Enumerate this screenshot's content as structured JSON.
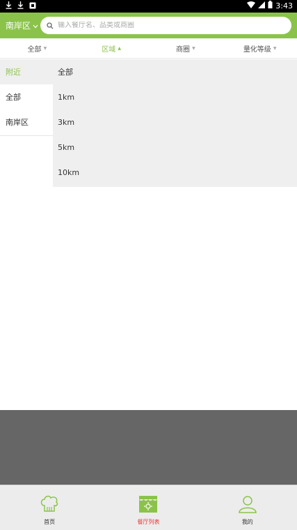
{
  "status_bar": {
    "time": "3:43"
  },
  "header": {
    "city_label": "南岸区",
    "search_placeholder": "输入餐厅名、品类或商圈"
  },
  "filter_bar": {
    "tabs": [
      {
        "label": "全部"
      },
      {
        "label": "区域"
      },
      {
        "label": "商圈"
      },
      {
        "label": "量化等级"
      }
    ]
  },
  "region_panel": {
    "left_items": [
      {
        "label": "附近"
      },
      {
        "label": "全部"
      },
      {
        "label": "南岸区"
      }
    ],
    "right_items": [
      {
        "label": "全部"
      },
      {
        "label": "1km"
      },
      {
        "label": "3km"
      },
      {
        "label": "5km"
      },
      {
        "label": "10km"
      }
    ]
  },
  "bottom_nav": {
    "items": [
      {
        "label": "首页"
      },
      {
        "label": "餐厅列表"
      },
      {
        "label": "我的"
      }
    ]
  },
  "colors": {
    "accent": "#8bc34a",
    "active_tab": "#e53935"
  }
}
